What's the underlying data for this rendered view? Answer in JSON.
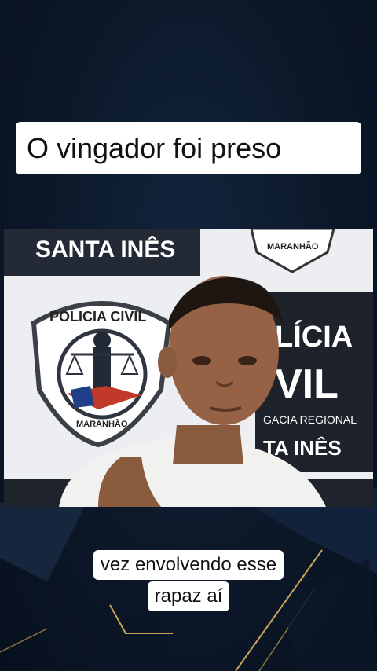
{
  "video": {
    "headline": "O vingador foi preso",
    "caption_lines": [
      "vez envolvendo esse",
      "rapaz aí"
    ]
  },
  "backdrop": {
    "banner_text": "SANTA INÊS",
    "left_badge": {
      "top": "POLICIA CIVIL",
      "bottom": "MARANHÃO"
    },
    "top_badge_bottom": "MARANHÃO",
    "right_panel": {
      "line1": "LÍCIA",
      "line2": "VIL",
      "line3": "GACIA REGIONAL",
      "line4": "TA INÊS"
    }
  },
  "colors": {
    "background": "#0d1a2d",
    "caption_bg": "#ffffff",
    "accent_gold": "#c9a45a"
  }
}
